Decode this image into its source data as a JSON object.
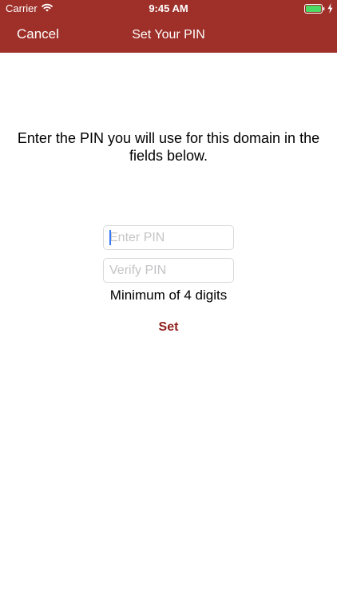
{
  "status_bar": {
    "carrier": "Carrier",
    "time": "9:45 AM",
    "icons": [
      "wifi-icon",
      "battery-icon",
      "charging-bolt-icon"
    ]
  },
  "nav_bar": {
    "cancel_label": "Cancel",
    "title": "Set Your PIN",
    "background_color": "#9e3029"
  },
  "main": {
    "instructions": "Enter the PIN you will use for this domain in the fields below.",
    "enter_pin": {
      "value": "",
      "placeholder": "Enter PIN"
    },
    "verify_pin": {
      "value": "",
      "placeholder": "Verify PIN"
    },
    "hint": "Minimum of 4 digits",
    "set_label": "Set",
    "set_color": "#8f1f1a"
  }
}
